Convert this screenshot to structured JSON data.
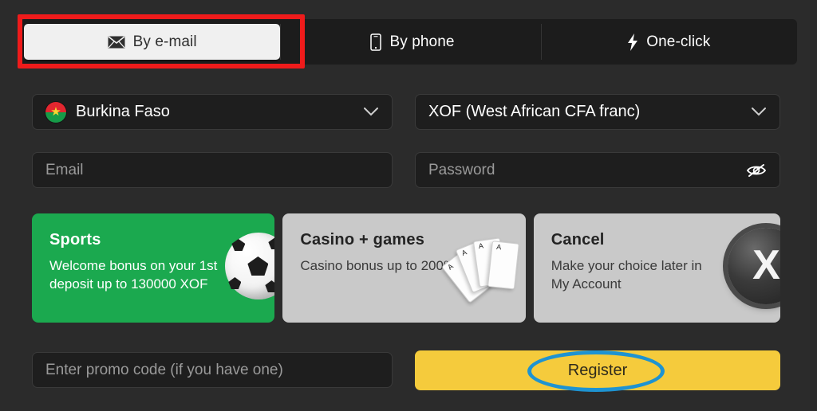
{
  "theme": {
    "page_bg": "#2b2b2b",
    "field_bg": "#1e1e1e",
    "accent_yellow": "#f5cb3c",
    "accent_green": "#1ba94f",
    "card_gray": "#c9c9c9",
    "annotation_red": "#ef1b1b",
    "annotation_blue": "#1e93d1"
  },
  "tabs": [
    {
      "label": "By e-mail",
      "icon": "envelope-icon",
      "active": true
    },
    {
      "label": "By phone",
      "icon": "mobile-phone-icon",
      "active": false
    },
    {
      "label": "One-click",
      "icon": "lightning-bolt-icon",
      "active": false
    }
  ],
  "country": {
    "label": "Burkina Faso",
    "flag_icon": "burkina-faso-flag-icon",
    "chevron_icon": "chevron-down-icon"
  },
  "currency": {
    "label": "XOF (West African CFA franc)",
    "chevron_icon": "chevron-down-icon"
  },
  "email": {
    "placeholder": "Email",
    "value": ""
  },
  "password": {
    "placeholder": "Password",
    "value": "",
    "toggle_icon": "eye-slash-icon"
  },
  "bonus_cards": [
    {
      "title": "Sports",
      "description": "Welcome bonus on your 1st deposit up to 130000 XOF",
      "art_icon": "soccer-ball-icon",
      "selected": true
    },
    {
      "title": "Casino + games",
      "description": "Casino bonus up to 200%",
      "art_icon": "playing-cards-aces-icon",
      "selected": false
    },
    {
      "title": "Cancel",
      "description": "Make your choice later in My Account",
      "art_icon": "circle-x-button-icon",
      "selected": false
    }
  ],
  "promo": {
    "placeholder": "Enter promo code (if you have one)",
    "value": ""
  },
  "register": {
    "label": "Register"
  },
  "ace_cards": [
    {
      "rank": "A",
      "suit": "♠"
    },
    {
      "rank": "A",
      "suit": "♣"
    },
    {
      "rank": "A",
      "suit": "♠"
    },
    {
      "rank": "A",
      "suit": "♣"
    }
  ],
  "x_button": {
    "glyph": "X"
  }
}
